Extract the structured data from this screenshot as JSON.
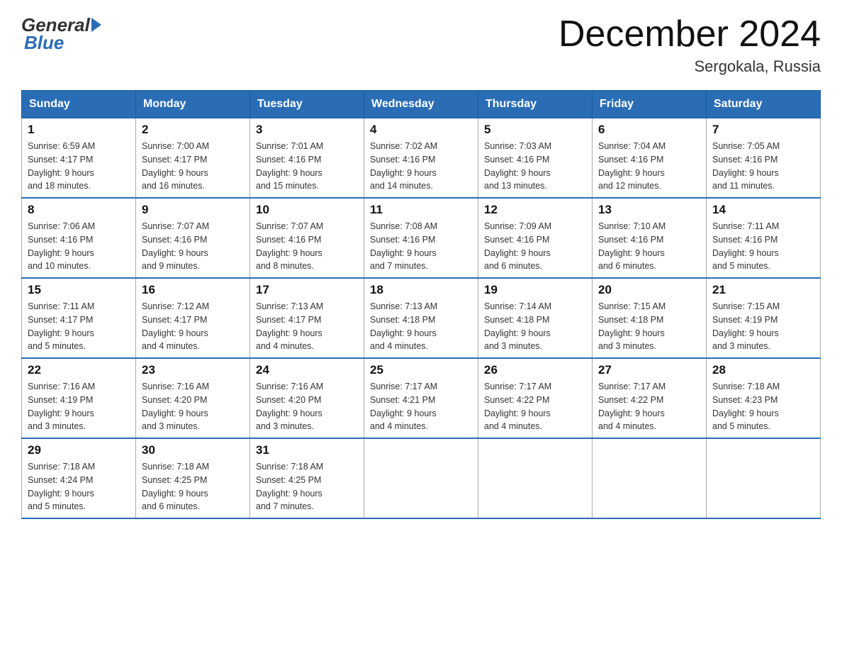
{
  "header": {
    "logo_general": "General",
    "logo_blue": "Blue",
    "month_title": "December 2024",
    "location": "Sergokala, Russia"
  },
  "weekdays": [
    "Sunday",
    "Monday",
    "Tuesday",
    "Wednesday",
    "Thursday",
    "Friday",
    "Saturday"
  ],
  "weeks": [
    [
      {
        "day": "1",
        "sunrise": "6:59 AM",
        "sunset": "4:17 PM",
        "daylight": "9 hours and 18 minutes."
      },
      {
        "day": "2",
        "sunrise": "7:00 AM",
        "sunset": "4:17 PM",
        "daylight": "9 hours and 16 minutes."
      },
      {
        "day": "3",
        "sunrise": "7:01 AM",
        "sunset": "4:16 PM",
        "daylight": "9 hours and 15 minutes."
      },
      {
        "day": "4",
        "sunrise": "7:02 AM",
        "sunset": "4:16 PM",
        "daylight": "9 hours and 14 minutes."
      },
      {
        "day": "5",
        "sunrise": "7:03 AM",
        "sunset": "4:16 PM",
        "daylight": "9 hours and 13 minutes."
      },
      {
        "day": "6",
        "sunrise": "7:04 AM",
        "sunset": "4:16 PM",
        "daylight": "9 hours and 12 minutes."
      },
      {
        "day": "7",
        "sunrise": "7:05 AM",
        "sunset": "4:16 PM",
        "daylight": "9 hours and 11 minutes."
      }
    ],
    [
      {
        "day": "8",
        "sunrise": "7:06 AM",
        "sunset": "4:16 PM",
        "daylight": "9 hours and 10 minutes."
      },
      {
        "day": "9",
        "sunrise": "7:07 AM",
        "sunset": "4:16 PM",
        "daylight": "9 hours and 9 minutes."
      },
      {
        "day": "10",
        "sunrise": "7:07 AM",
        "sunset": "4:16 PM",
        "daylight": "9 hours and 8 minutes."
      },
      {
        "day": "11",
        "sunrise": "7:08 AM",
        "sunset": "4:16 PM",
        "daylight": "9 hours and 7 minutes."
      },
      {
        "day": "12",
        "sunrise": "7:09 AM",
        "sunset": "4:16 PM",
        "daylight": "9 hours and 6 minutes."
      },
      {
        "day": "13",
        "sunrise": "7:10 AM",
        "sunset": "4:16 PM",
        "daylight": "9 hours and 6 minutes."
      },
      {
        "day": "14",
        "sunrise": "7:11 AM",
        "sunset": "4:16 PM",
        "daylight": "9 hours and 5 minutes."
      }
    ],
    [
      {
        "day": "15",
        "sunrise": "7:11 AM",
        "sunset": "4:17 PM",
        "daylight": "9 hours and 5 minutes."
      },
      {
        "day": "16",
        "sunrise": "7:12 AM",
        "sunset": "4:17 PM",
        "daylight": "9 hours and 4 minutes."
      },
      {
        "day": "17",
        "sunrise": "7:13 AM",
        "sunset": "4:17 PM",
        "daylight": "9 hours and 4 minutes."
      },
      {
        "day": "18",
        "sunrise": "7:13 AM",
        "sunset": "4:18 PM",
        "daylight": "9 hours and 4 minutes."
      },
      {
        "day": "19",
        "sunrise": "7:14 AM",
        "sunset": "4:18 PM",
        "daylight": "9 hours and 3 minutes."
      },
      {
        "day": "20",
        "sunrise": "7:15 AM",
        "sunset": "4:18 PM",
        "daylight": "9 hours and 3 minutes."
      },
      {
        "day": "21",
        "sunrise": "7:15 AM",
        "sunset": "4:19 PM",
        "daylight": "9 hours and 3 minutes."
      }
    ],
    [
      {
        "day": "22",
        "sunrise": "7:16 AM",
        "sunset": "4:19 PM",
        "daylight": "9 hours and 3 minutes."
      },
      {
        "day": "23",
        "sunrise": "7:16 AM",
        "sunset": "4:20 PM",
        "daylight": "9 hours and 3 minutes."
      },
      {
        "day": "24",
        "sunrise": "7:16 AM",
        "sunset": "4:20 PM",
        "daylight": "9 hours and 3 minutes."
      },
      {
        "day": "25",
        "sunrise": "7:17 AM",
        "sunset": "4:21 PM",
        "daylight": "9 hours and 4 minutes."
      },
      {
        "day": "26",
        "sunrise": "7:17 AM",
        "sunset": "4:22 PM",
        "daylight": "9 hours and 4 minutes."
      },
      {
        "day": "27",
        "sunrise": "7:17 AM",
        "sunset": "4:22 PM",
        "daylight": "9 hours and 4 minutes."
      },
      {
        "day": "28",
        "sunrise": "7:18 AM",
        "sunset": "4:23 PM",
        "daylight": "9 hours and 5 minutes."
      }
    ],
    [
      {
        "day": "29",
        "sunrise": "7:18 AM",
        "sunset": "4:24 PM",
        "daylight": "9 hours and 5 minutes."
      },
      {
        "day": "30",
        "sunrise": "7:18 AM",
        "sunset": "4:25 PM",
        "daylight": "9 hours and 6 minutes."
      },
      {
        "day": "31",
        "sunrise": "7:18 AM",
        "sunset": "4:25 PM",
        "daylight": "9 hours and 7 minutes."
      },
      null,
      null,
      null,
      null
    ]
  ],
  "labels": {
    "sunrise": "Sunrise:",
    "sunset": "Sunset:",
    "daylight": "Daylight:"
  }
}
